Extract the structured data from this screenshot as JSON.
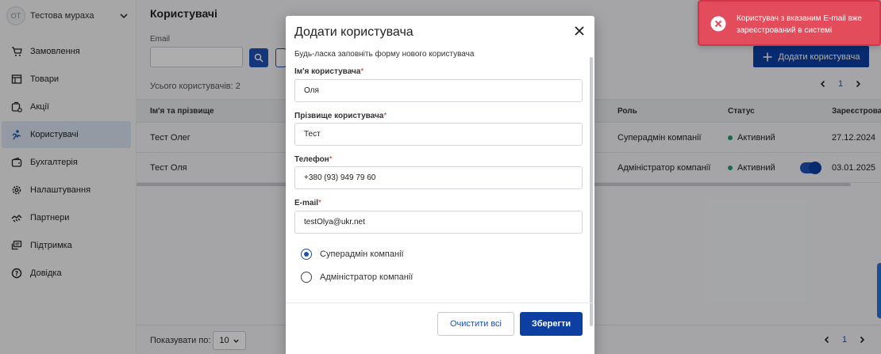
{
  "sidebar": {
    "avatar_initials": "OT",
    "company_name": "Тестова мураха",
    "items": [
      {
        "label": "Замовлення",
        "icon": "cart-icon"
      },
      {
        "label": "Товари",
        "icon": "box-icon"
      },
      {
        "label": "Акції",
        "icon": "tag-icon"
      },
      {
        "label": "Користувачі",
        "icon": "users-icon",
        "active": true
      },
      {
        "label": "Бухгалтерія",
        "icon": "wallet-icon"
      },
      {
        "label": "Налаштування",
        "icon": "gear-icon"
      },
      {
        "label": "Партнери",
        "icon": "handshake-icon"
      },
      {
        "label": "Підтримка",
        "icon": "chat-icon"
      },
      {
        "label": "Довідка",
        "icon": "help-icon"
      }
    ]
  },
  "main": {
    "title": "Користувачі",
    "filter": {
      "email_label": "Email",
      "email_value": ""
    },
    "add_button_label": "Додати користувача",
    "total_label": "Усього користувачів: 2",
    "current_page": "1",
    "table": {
      "headers": {
        "name": "Ім'я та прізвище",
        "role": "Роль",
        "status": "Статус",
        "registered": "Зареєстрован"
      },
      "rows": [
        {
          "name": "Тест Олег",
          "role": "Суперадмін компанії",
          "status": "Активний",
          "registered": "27.12.2024"
        },
        {
          "name": "Тест Оля",
          "role": "Адміністратор компанії",
          "status": "Активний",
          "registered": "03.01.2025"
        }
      ]
    },
    "footer": {
      "per_page_label": "Показувати по:",
      "per_page_value": "10",
      "current_page": "1"
    }
  },
  "modal": {
    "title": "Додати користувача",
    "subtitle": "Будь-ласка заповніть форму нового користувача",
    "fields": [
      {
        "label": "Ім'я користувача",
        "value": "Оля"
      },
      {
        "label": "Прізвище користувача",
        "value": "Тест"
      },
      {
        "label": "Телефон",
        "value": "+380 (93) 949 79 60"
      },
      {
        "label": "E-mail",
        "value": "testOlya@ukr.net"
      }
    ],
    "required_mark": "*",
    "roles": [
      {
        "label": "Суперадмін компанії",
        "selected": true
      },
      {
        "label": "Адміністратор компанії",
        "selected": false
      }
    ],
    "clear_label": "Очистити всі",
    "save_label": "Зберегти"
  },
  "toast": {
    "message": "Користувач з вказаним E-mail вже зареєстрований в системі",
    "type": "error",
    "color": "#e24c5b"
  },
  "colors": {
    "primary": "#0d3fa3",
    "accent": "#1e50b4",
    "active_status": "#22a06b",
    "required": "#d32f2f"
  }
}
